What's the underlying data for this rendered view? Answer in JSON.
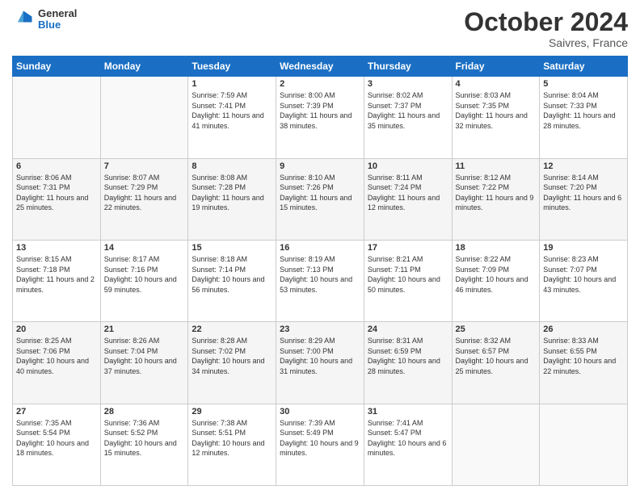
{
  "header": {
    "logo": {
      "general": "General",
      "blue": "Blue"
    },
    "title": "October 2024",
    "location": "Saivres, France"
  },
  "calendar": {
    "days_of_week": [
      "Sunday",
      "Monday",
      "Tuesday",
      "Wednesday",
      "Thursday",
      "Friday",
      "Saturday"
    ],
    "weeks": [
      [
        {
          "day": "",
          "sunrise": "",
          "sunset": "",
          "daylight": ""
        },
        {
          "day": "",
          "sunrise": "",
          "sunset": "",
          "daylight": ""
        },
        {
          "day": "1",
          "sunrise": "Sunrise: 7:59 AM",
          "sunset": "Sunset: 7:41 PM",
          "daylight": "Daylight: 11 hours and 41 minutes."
        },
        {
          "day": "2",
          "sunrise": "Sunrise: 8:00 AM",
          "sunset": "Sunset: 7:39 PM",
          "daylight": "Daylight: 11 hours and 38 minutes."
        },
        {
          "day": "3",
          "sunrise": "Sunrise: 8:02 AM",
          "sunset": "Sunset: 7:37 PM",
          "daylight": "Daylight: 11 hours and 35 minutes."
        },
        {
          "day": "4",
          "sunrise": "Sunrise: 8:03 AM",
          "sunset": "Sunset: 7:35 PM",
          "daylight": "Daylight: 11 hours and 32 minutes."
        },
        {
          "day": "5",
          "sunrise": "Sunrise: 8:04 AM",
          "sunset": "Sunset: 7:33 PM",
          "daylight": "Daylight: 11 hours and 28 minutes."
        }
      ],
      [
        {
          "day": "6",
          "sunrise": "Sunrise: 8:06 AM",
          "sunset": "Sunset: 7:31 PM",
          "daylight": "Daylight: 11 hours and 25 minutes."
        },
        {
          "day": "7",
          "sunrise": "Sunrise: 8:07 AM",
          "sunset": "Sunset: 7:29 PM",
          "daylight": "Daylight: 11 hours and 22 minutes."
        },
        {
          "day": "8",
          "sunrise": "Sunrise: 8:08 AM",
          "sunset": "Sunset: 7:28 PM",
          "daylight": "Daylight: 11 hours and 19 minutes."
        },
        {
          "day": "9",
          "sunrise": "Sunrise: 8:10 AM",
          "sunset": "Sunset: 7:26 PM",
          "daylight": "Daylight: 11 hours and 15 minutes."
        },
        {
          "day": "10",
          "sunrise": "Sunrise: 8:11 AM",
          "sunset": "Sunset: 7:24 PM",
          "daylight": "Daylight: 11 hours and 12 minutes."
        },
        {
          "day": "11",
          "sunrise": "Sunrise: 8:12 AM",
          "sunset": "Sunset: 7:22 PM",
          "daylight": "Daylight: 11 hours and 9 minutes."
        },
        {
          "day": "12",
          "sunrise": "Sunrise: 8:14 AM",
          "sunset": "Sunset: 7:20 PM",
          "daylight": "Daylight: 11 hours and 6 minutes."
        }
      ],
      [
        {
          "day": "13",
          "sunrise": "Sunrise: 8:15 AM",
          "sunset": "Sunset: 7:18 PM",
          "daylight": "Daylight: 11 hours and 2 minutes."
        },
        {
          "day": "14",
          "sunrise": "Sunrise: 8:17 AM",
          "sunset": "Sunset: 7:16 PM",
          "daylight": "Daylight: 10 hours and 59 minutes."
        },
        {
          "day": "15",
          "sunrise": "Sunrise: 8:18 AM",
          "sunset": "Sunset: 7:14 PM",
          "daylight": "Daylight: 10 hours and 56 minutes."
        },
        {
          "day": "16",
          "sunrise": "Sunrise: 8:19 AM",
          "sunset": "Sunset: 7:13 PM",
          "daylight": "Daylight: 10 hours and 53 minutes."
        },
        {
          "day": "17",
          "sunrise": "Sunrise: 8:21 AM",
          "sunset": "Sunset: 7:11 PM",
          "daylight": "Daylight: 10 hours and 50 minutes."
        },
        {
          "day": "18",
          "sunrise": "Sunrise: 8:22 AM",
          "sunset": "Sunset: 7:09 PM",
          "daylight": "Daylight: 10 hours and 46 minutes."
        },
        {
          "day": "19",
          "sunrise": "Sunrise: 8:23 AM",
          "sunset": "Sunset: 7:07 PM",
          "daylight": "Daylight: 10 hours and 43 minutes."
        }
      ],
      [
        {
          "day": "20",
          "sunrise": "Sunrise: 8:25 AM",
          "sunset": "Sunset: 7:06 PM",
          "daylight": "Daylight: 10 hours and 40 minutes."
        },
        {
          "day": "21",
          "sunrise": "Sunrise: 8:26 AM",
          "sunset": "Sunset: 7:04 PM",
          "daylight": "Daylight: 10 hours and 37 minutes."
        },
        {
          "day": "22",
          "sunrise": "Sunrise: 8:28 AM",
          "sunset": "Sunset: 7:02 PM",
          "daylight": "Daylight: 10 hours and 34 minutes."
        },
        {
          "day": "23",
          "sunrise": "Sunrise: 8:29 AM",
          "sunset": "Sunset: 7:00 PM",
          "daylight": "Daylight: 10 hours and 31 minutes."
        },
        {
          "day": "24",
          "sunrise": "Sunrise: 8:31 AM",
          "sunset": "Sunset: 6:59 PM",
          "daylight": "Daylight: 10 hours and 28 minutes."
        },
        {
          "day": "25",
          "sunrise": "Sunrise: 8:32 AM",
          "sunset": "Sunset: 6:57 PM",
          "daylight": "Daylight: 10 hours and 25 minutes."
        },
        {
          "day": "26",
          "sunrise": "Sunrise: 8:33 AM",
          "sunset": "Sunset: 6:55 PM",
          "daylight": "Daylight: 10 hours and 22 minutes."
        }
      ],
      [
        {
          "day": "27",
          "sunrise": "Sunrise: 7:35 AM",
          "sunset": "Sunset: 5:54 PM",
          "daylight": "Daylight: 10 hours and 18 minutes."
        },
        {
          "day": "28",
          "sunrise": "Sunrise: 7:36 AM",
          "sunset": "Sunset: 5:52 PM",
          "daylight": "Daylight: 10 hours and 15 minutes."
        },
        {
          "day": "29",
          "sunrise": "Sunrise: 7:38 AM",
          "sunset": "Sunset: 5:51 PM",
          "daylight": "Daylight: 10 hours and 12 minutes."
        },
        {
          "day": "30",
          "sunrise": "Sunrise: 7:39 AM",
          "sunset": "Sunset: 5:49 PM",
          "daylight": "Daylight: 10 hours and 9 minutes."
        },
        {
          "day": "31",
          "sunrise": "Sunrise: 7:41 AM",
          "sunset": "Sunset: 5:47 PM",
          "daylight": "Daylight: 10 hours and 6 minutes."
        },
        {
          "day": "",
          "sunrise": "",
          "sunset": "",
          "daylight": ""
        },
        {
          "day": "",
          "sunrise": "",
          "sunset": "",
          "daylight": ""
        }
      ]
    ]
  }
}
